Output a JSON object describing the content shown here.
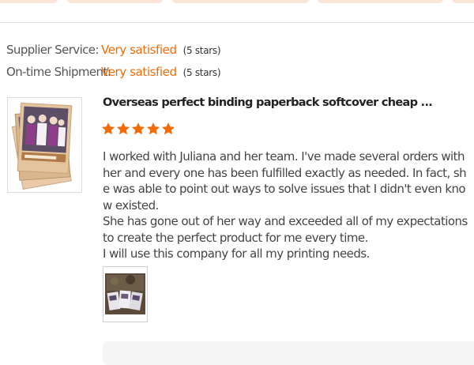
{
  "ratings": [
    {
      "label": "Supplier Service:",
      "value": "Very satisfied",
      "stars_text": "(5 stars)"
    },
    {
      "label": "On-time Shipment:",
      "value": "Very satisfied",
      "stars_text": "(5 stars)"
    }
  ],
  "review": {
    "product_title": "Overseas perfect binding paperback softcover cheap ...",
    "star_rating": 5,
    "star_color": "#f26b07",
    "body_paragraphs": [
      "I worked with Juliana and her team. I've made several orders with her and every one has been fulfilled exactly as needed. In fact, she was able to point out ways to solve issues that I didn't even know existed.",
      "She has gone out of her way and exceeded all of my expectations to create the perfect product for me every time.",
      "I will use this company for all my printing needs."
    ]
  },
  "colors": {
    "accent": "#f26b07",
    "tab_chip": "#fce4d6",
    "divider": "#e3e3e3"
  },
  "icons": {
    "star": "star-icon"
  }
}
